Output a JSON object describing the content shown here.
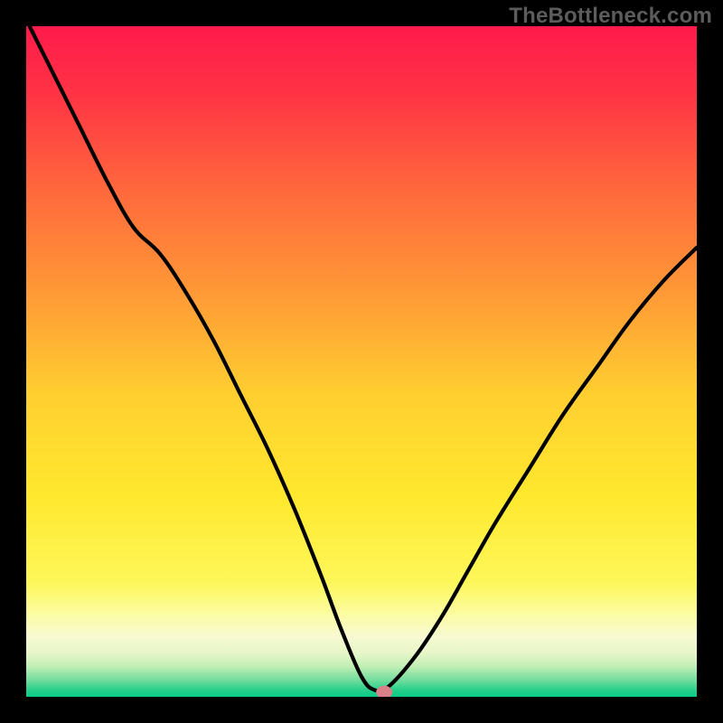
{
  "watermark": "TheBottleneck.com",
  "chart_data": {
    "type": "line",
    "title": "",
    "xlabel": "",
    "ylabel": "",
    "xlim": [
      0,
      100
    ],
    "ylim": [
      0,
      100
    ],
    "description": "Bottleneck percentage curve over component-balance axis. Vertical position = bottleneck % (top = 100% bottleneck, bottom green = ~0%). Gradient background encodes severity: red = severe, yellow = moderate, green = none. The curve descends from far left, reaches ~0 near x=52, then rises on the right.",
    "gradient_stops": [
      {
        "offset": 0.0,
        "color": "#ff1a4b"
      },
      {
        "offset": 0.1,
        "color": "#ff3345"
      },
      {
        "offset": 0.25,
        "color": "#ff6a3c"
      },
      {
        "offset": 0.4,
        "color": "#ff9a36"
      },
      {
        "offset": 0.55,
        "color": "#ffcf30"
      },
      {
        "offset": 0.7,
        "color": "#ffe82e"
      },
      {
        "offset": 0.83,
        "color": "#fdf75a"
      },
      {
        "offset": 0.88,
        "color": "#fcfca8"
      },
      {
        "offset": 0.91,
        "color": "#f7fad2"
      },
      {
        "offset": 0.935,
        "color": "#e7f6c8"
      },
      {
        "offset": 0.955,
        "color": "#c0eeb5"
      },
      {
        "offset": 0.975,
        "color": "#72dd9e"
      },
      {
        "offset": 0.99,
        "color": "#26d08a"
      },
      {
        "offset": 1.0,
        "color": "#0acb86"
      }
    ],
    "series": [
      {
        "name": "bottleneck",
        "x": [
          0.5,
          4,
          8,
          12,
          16,
          20,
          24,
          28,
          32,
          36,
          40,
          44,
          47,
          50,
          52,
          54,
          58,
          62,
          66,
          70,
          75,
          80,
          85,
          90,
          95,
          100
        ],
        "y": [
          100,
          93,
          85,
          77,
          70,
          66,
          60,
          53,
          45,
          37,
          28,
          18,
          10,
          3,
          1,
          1.5,
          6,
          12,
          19,
          26,
          34,
          42,
          49,
          56,
          62,
          67
        ]
      }
    ],
    "marker": {
      "x": 53.4,
      "y": 0.7
    }
  }
}
